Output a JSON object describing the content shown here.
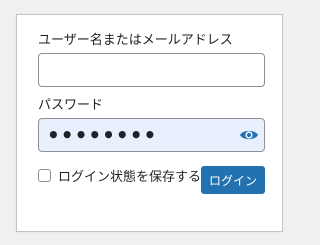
{
  "login_form": {
    "username_label": "ユーザー名またはメールアドレス",
    "username_value": "",
    "password_label": "パスワード",
    "password_value": "••••••••",
    "show_password_icon": "eye-icon",
    "remember_label": "ログイン状態を保存する",
    "remember_checked": false,
    "submit_label": "ログイン"
  },
  "colors": {
    "page_background": "#f0f0f1",
    "primary_button": "#2271b1",
    "password_field_fill": "#e8f0fe",
    "eye_icon": "#2271b1"
  }
}
